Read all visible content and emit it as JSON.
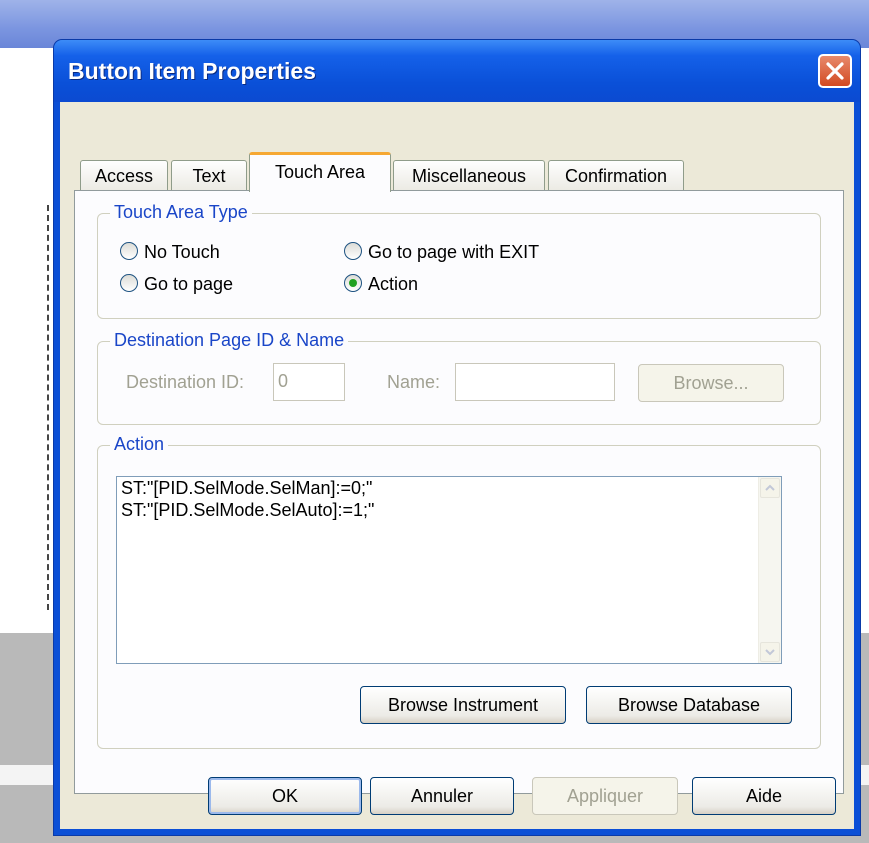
{
  "dialog": {
    "title": "Button Item Properties"
  },
  "tabs": [
    {
      "label": "Access"
    },
    {
      "label": "Text"
    },
    {
      "label": "Touch Area"
    },
    {
      "label": "Miscellaneous"
    },
    {
      "label": "Confirmation"
    }
  ],
  "active_tab": "Touch Area",
  "touch_area_type": {
    "legend": "Touch Area Type",
    "options": [
      {
        "label": "No Touch",
        "selected": false
      },
      {
        "label": "Go to page with EXIT",
        "selected": false
      },
      {
        "label": "Go to page",
        "selected": false
      },
      {
        "label": "Action",
        "selected": true
      }
    ]
  },
  "destination": {
    "legend": "Destination Page ID & Name",
    "id_label": "Destination ID:",
    "id_value": "0",
    "name_label": "Name:",
    "name_value": "",
    "browse_label": "Browse..."
  },
  "action": {
    "legend": "Action",
    "lines": [
      "ST:\"[PID.SelMode.SelMan]:=0;\"",
      "ST:\"[PID.SelMode.SelAuto]:=1;\""
    ],
    "browse_instrument_label": "Browse Instrument",
    "browse_database_label": "Browse Database"
  },
  "footer": {
    "ok_label": "OK",
    "cancel_label": "Annuler",
    "apply_label": "Appliquer",
    "help_label": "Aide"
  },
  "colors": {
    "titlebar": "#0a50d8",
    "group_legend": "#1a46c8",
    "active_tab_accent": "#f6a833",
    "radio_selected": "#21a121"
  }
}
